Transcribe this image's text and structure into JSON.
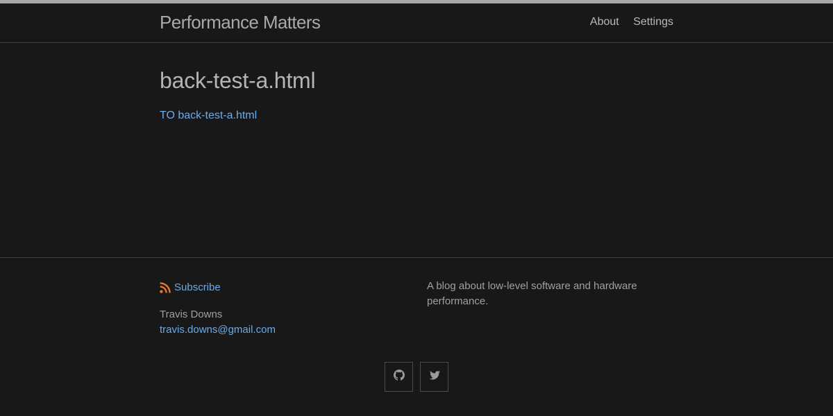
{
  "header": {
    "site_title": "Performance Matters",
    "nav": [
      {
        "label": "About"
      },
      {
        "label": "Settings"
      }
    ]
  },
  "main": {
    "title": "back-test-a.html",
    "link_text": "TO back-test-a.html"
  },
  "footer": {
    "subscribe_label": "Subscribe",
    "author_name": "Travis Downs",
    "author_email": "travis.downs@gmail.com",
    "description": "A blog about low-level software and hardware performance.",
    "social": [
      {
        "icon": "github-icon"
      },
      {
        "icon": "twitter-icon"
      }
    ]
  },
  "colors": {
    "background": "#181818",
    "link": "#6cacea",
    "rss_accent": "#e8772e",
    "text_muted": "#a0a0a0"
  }
}
